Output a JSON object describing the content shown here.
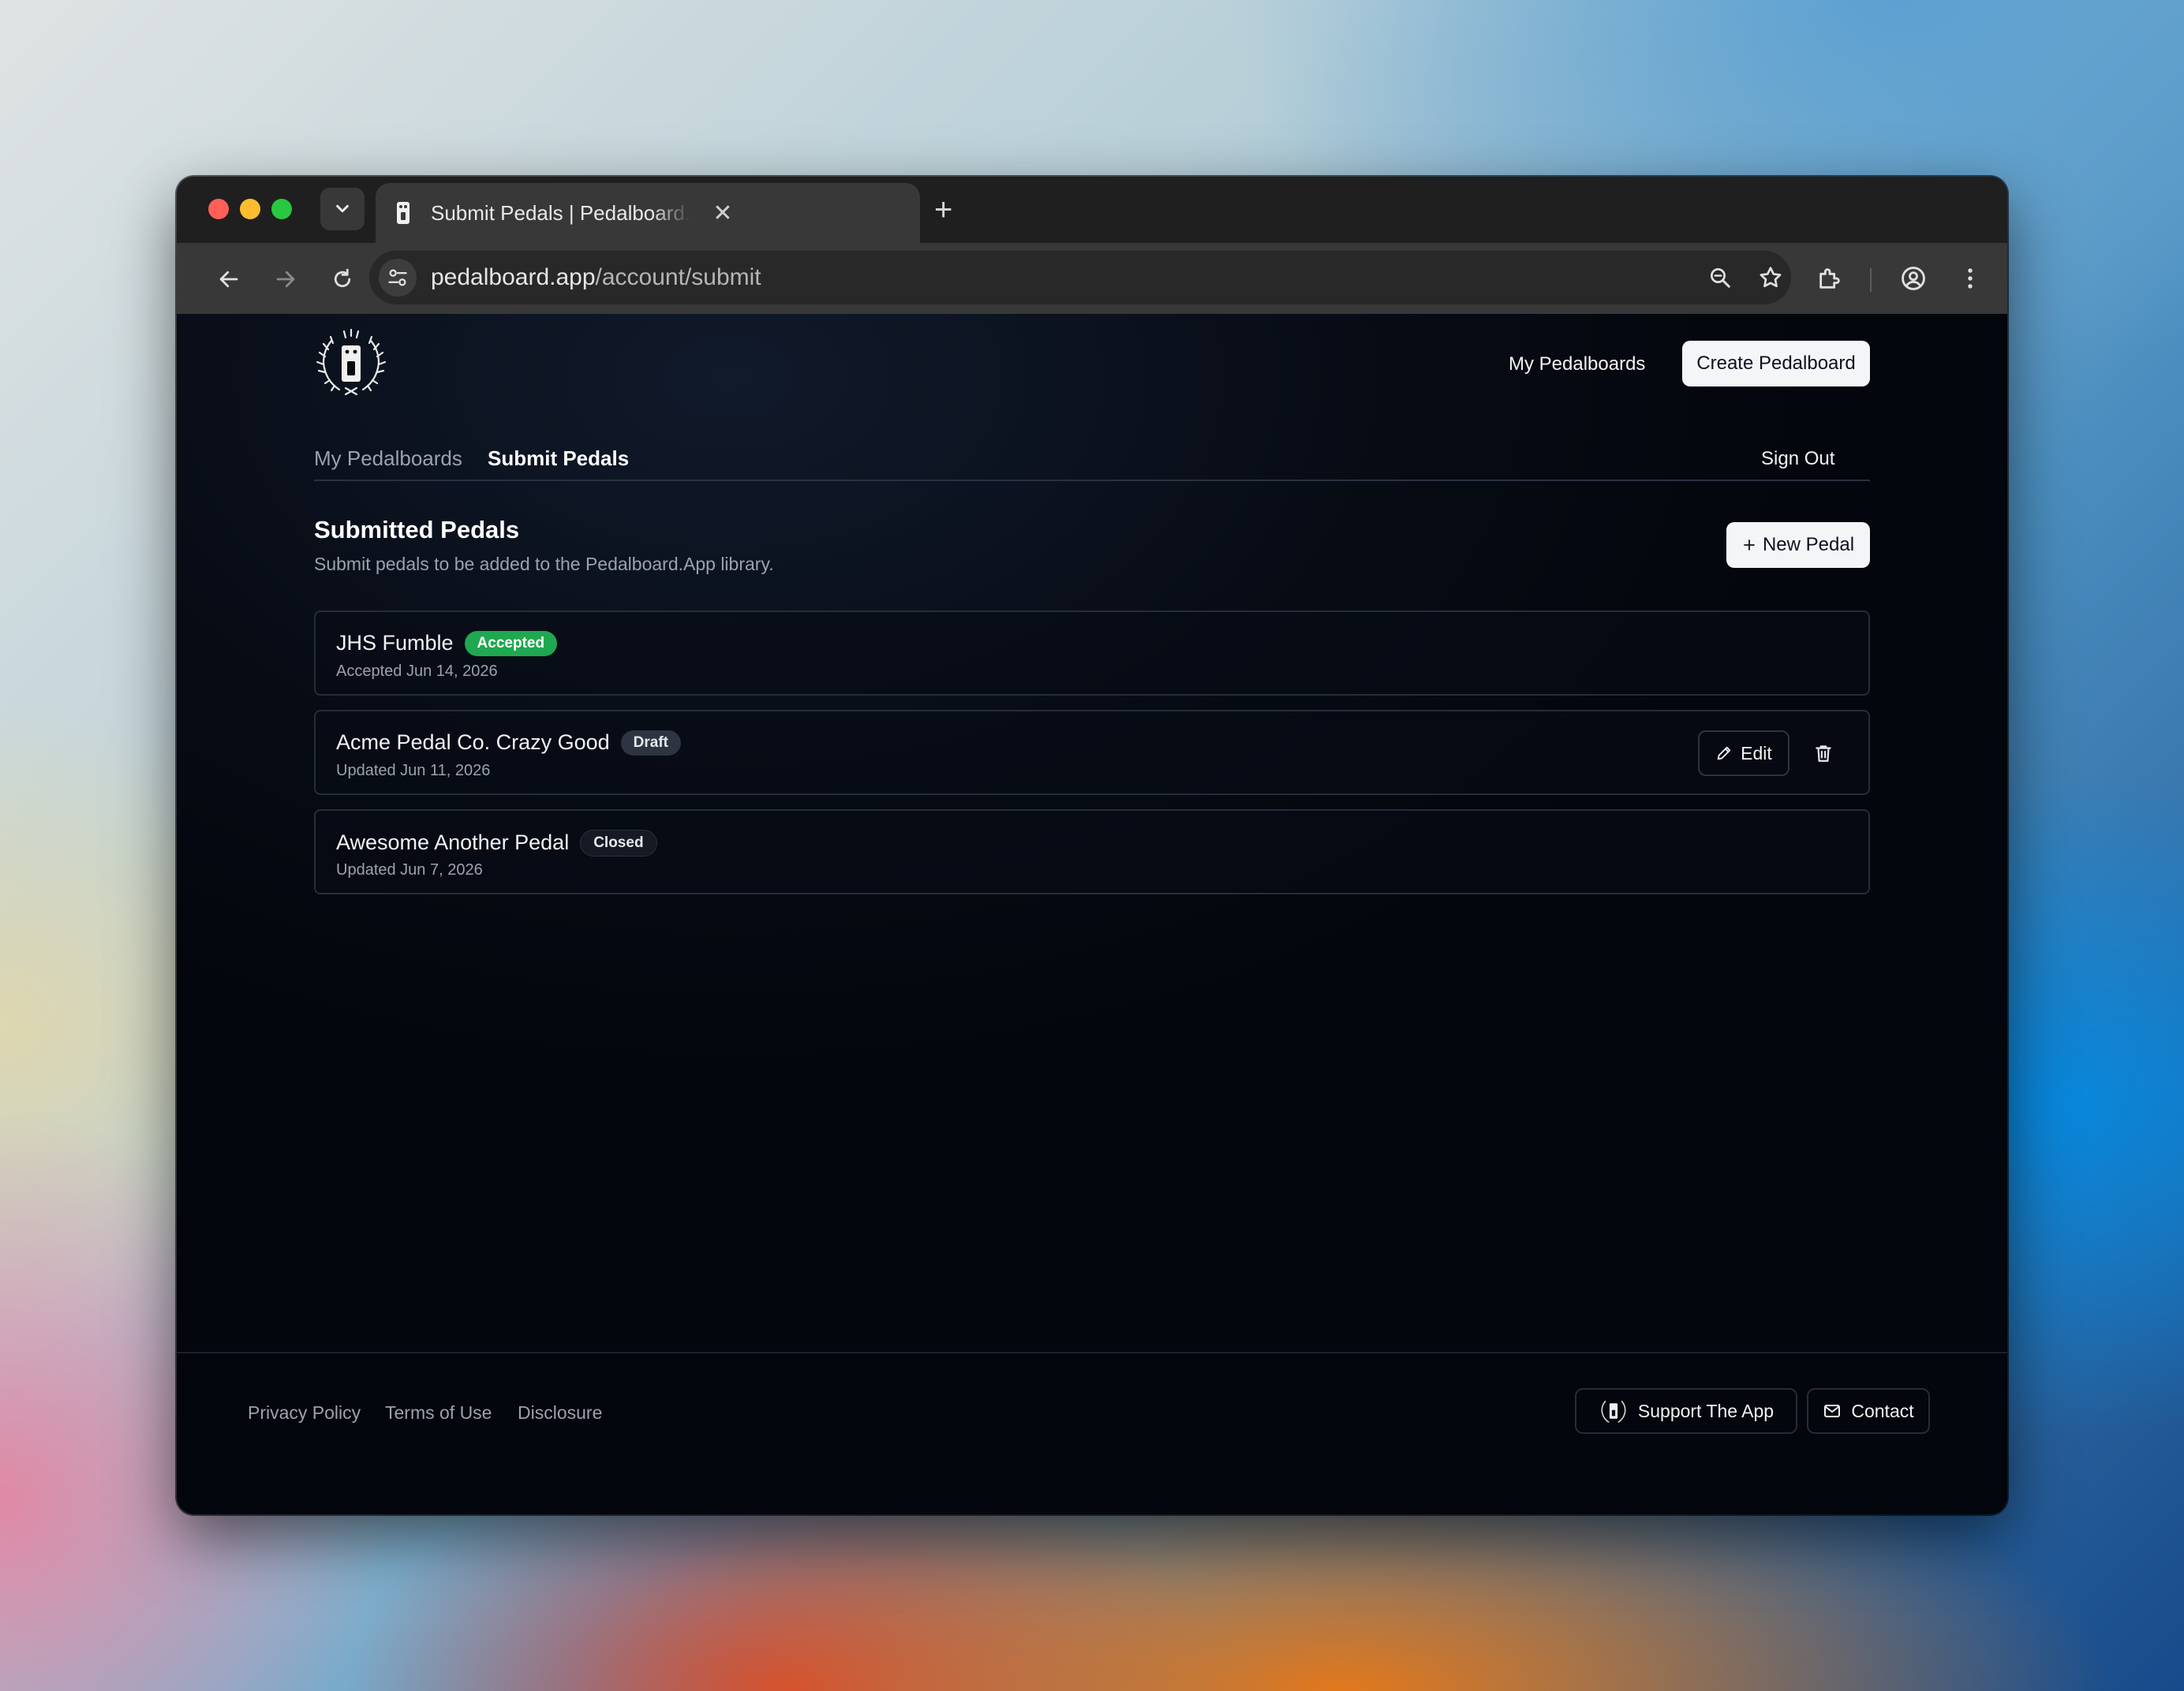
{
  "browser": {
    "tab_title": "Submit Pedals | Pedalboard.App",
    "url_host": "pedalboard.app",
    "url_path": "/account/submit"
  },
  "header": {
    "nav_link": "My Pedalboards",
    "create_button": "Create Pedalboard"
  },
  "subnav": {
    "tabs": [
      {
        "label": "My Pedalboards"
      },
      {
        "label": "Submit Pedals"
      }
    ],
    "sign_out": "Sign Out"
  },
  "main": {
    "title": "Submitted Pedals",
    "subtitle": "Submit pedals to be added to the Pedalboard.App library.",
    "new_button": "New Pedal",
    "pedals": [
      {
        "name": "JHS Fumble",
        "status": "Accepted",
        "date": "Accepted Jun 14, 2026"
      },
      {
        "name": "Acme Pedal Co. Crazy Good",
        "status": "Draft",
        "date": "Updated Jun 11, 2026",
        "edit_label": "Edit"
      },
      {
        "name": "Awesome Another Pedal",
        "status": "Closed",
        "date": "Updated Jun 7, 2026"
      }
    ]
  },
  "footer": {
    "links": [
      "Privacy Policy",
      "Terms of Use",
      "Disclosure"
    ],
    "support": "Support The App",
    "contact": "Contact"
  },
  "colors": {
    "accepted": "#1fa84f",
    "page_bg": "#070b14",
    "button_bg": "#f4f5f7"
  }
}
